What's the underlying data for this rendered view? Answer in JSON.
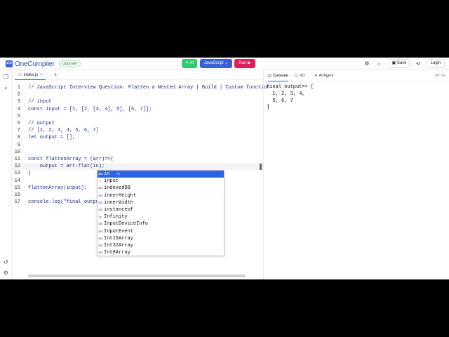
{
  "header": {
    "brand": "OneCompiler",
    "upgrade_label": "Upgrade",
    "ai_label": "AI",
    "language_label": "JavaScript",
    "run_label": "Run",
    "save_label": "Save",
    "login_label": "Login"
  },
  "editor": {
    "tab_label": "index.js",
    "lines": [
      {
        "n": "1",
        "text": "// JavaScript Interview Question: Flatten a Nested Array | Build | Custom function"
      },
      {
        "n": "2",
        "text": ""
      },
      {
        "n": "3",
        "text": "// input"
      },
      {
        "n": "4",
        "text": "const input = [1, [2, [3, 4], 5], [6, 7]];"
      },
      {
        "n": "5",
        "text": ""
      },
      {
        "n": "6",
        "text": "// output"
      },
      {
        "n": "7",
        "text": "// [1, 2, 3, 4, 5, 6, 7]"
      },
      {
        "n": "8",
        "text": "let output = [];"
      },
      {
        "n": "9",
        "text": ""
      },
      {
        "n": "10",
        "text": ""
      },
      {
        "n": "11",
        "text": "const flattenArray = (arr)=>{"
      },
      {
        "n": "12",
        "text": "    output = arr.flat(in);"
      },
      {
        "n": "13",
        "text": "}"
      },
      {
        "n": "14",
        "text": ""
      },
      {
        "n": "15",
        "text": "flattenArray(input);"
      },
      {
        "n": "16",
        "text": ""
      },
      {
        "n": "17",
        "text": "console.log(\"final outpu"
      }
    ]
  },
  "suggestions": [
    {
      "label": "in",
      "detail": "in",
      "icon": "keyword-icon"
    },
    {
      "label": "input",
      "icon": "variable-icon"
    },
    {
      "label": "indexedDB",
      "icon": "keyword-icon"
    },
    {
      "label": "innerHeight",
      "icon": "keyword-icon"
    },
    {
      "label": "innerWidth",
      "icon": "keyword-icon"
    },
    {
      "label": "instanceof",
      "icon": "keyword-icon"
    },
    {
      "label": "Infinity",
      "icon": "constant-icon"
    },
    {
      "label": "InputDeviceInfo",
      "icon": "keyword-icon"
    },
    {
      "label": "InputEvent",
      "icon": "keyword-icon"
    },
    {
      "label": "Int16Array",
      "icon": "keyword-icon"
    },
    {
      "label": "Int32Array",
      "icon": "keyword-icon"
    },
    {
      "label": "Int8Array",
      "icon": "keyword-icon"
    }
  ],
  "panel": {
    "tabs": [
      "Console",
      "I/O",
      "AI Agent"
    ],
    "time": "147 ms",
    "output_lines": [
      "final output=> [",
      "  1, 2, 3, 4,",
      "  5, 6, 7",
      "]"
    ]
  },
  "colors": {
    "accent": "#3a5fd6",
    "run": "#e5195f",
    "ai": "#2ecc71",
    "selection": "#2f63e6"
  }
}
